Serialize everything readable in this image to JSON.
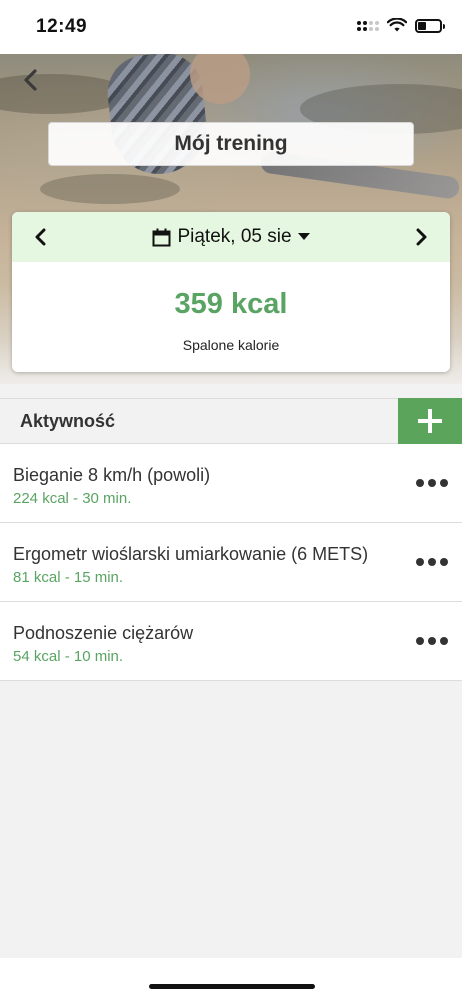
{
  "status_bar": {
    "time": "12:49"
  },
  "header": {
    "title": "Mój trening"
  },
  "summary": {
    "date": "Piątek, 05 sie",
    "calories": "359 kcal",
    "calories_label": "Spalone kalorie"
  },
  "activity": {
    "title": "Aktywność",
    "items": [
      {
        "name": "Bieganie 8 km/h (powoli)",
        "meta": "224 kcal - 30 min."
      },
      {
        "name": "Ergometr wioślarski umiarkowanie (6 METS)",
        "meta": "81 kcal - 15 min."
      },
      {
        "name": "Podnoszenie ciężarów",
        "meta": "54 kcal - 10 min."
      }
    ]
  },
  "icons": {
    "back": "chevron-left-icon",
    "prev": "chevron-left-icon",
    "next": "chevron-right-icon",
    "calendar": "calendar-icon",
    "dropdown": "caret-down-icon",
    "add": "plus-icon",
    "more": "more-horizontal-icon"
  },
  "colors": {
    "accent": "#5aa463",
    "add_button": "#5aa55b",
    "date_row_bg": "#e6f7e1"
  }
}
